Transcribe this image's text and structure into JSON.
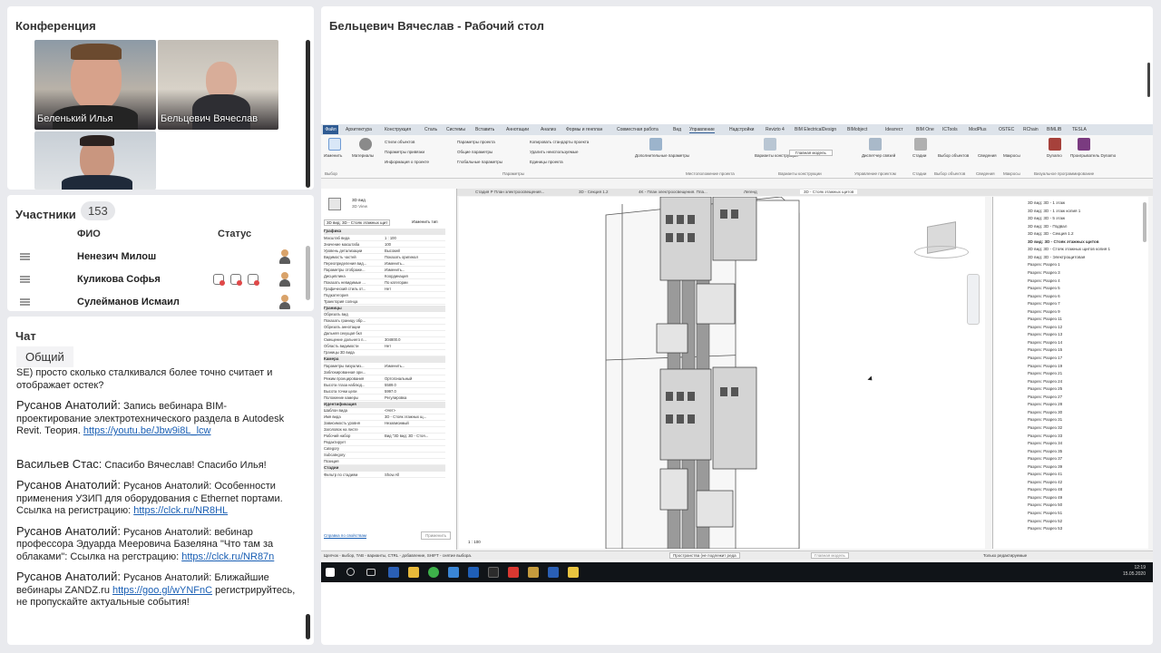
{
  "conference": {
    "title": "Конференция",
    "videos": [
      {
        "name": "Беленький Илья"
      },
      {
        "name": "Бельцевич Вячеслав"
      },
      {
        "name": ""
      }
    ]
  },
  "participants": {
    "title": "Участники",
    "count": "153",
    "col_name": "ФИО",
    "col_status": "Статус",
    "rows": [
      {
        "name": "Ненезич Милош"
      },
      {
        "name": "Куликова Софья"
      },
      {
        "name": "Сулейманов Исмаил"
      }
    ]
  },
  "chat": {
    "title": "Чат",
    "tab": "Общий",
    "intro": "SE) просто сколько сталкивался более точно считает и отображает остек?",
    "messages": [
      {
        "who": "Русанов Анатолий:",
        "text": "Запись вебинара BIM-проектирование электротехнического раздела в Autodesk Revit. Теория.",
        "link": "https://youtu.be/Jbw9i8L_lcw"
      },
      {
        "who": "Васильев Стас:",
        "text": "Спасибо Вячеслав! Спасибо Илья!",
        "link": ""
      },
      {
        "who": "Русанов Анатолий:",
        "text": "Русанов Анатолий: Особенности применения УЗИП для оборудования с Ethernet портами. Ссылка на регистрацию:",
        "link": "https://clck.ru/NR8HL"
      },
      {
        "who": "Русанов Анатолий:",
        "text": "Русанов Анатолий: вебинар профессора Эдуарда Мееровича Базеляна \"Что там за облаками\": Ссылка на регстрацию:",
        "link": "https://clck.ru/NR87n"
      },
      {
        "who": "Русанов Анатолий:",
        "text": "Русанов Анатолий: Ближайшие вебинары ZANDZ.ru",
        "link": "https://goo.gl/wYNFnC",
        "after": "регистрируйтесь, не пропускайте актуальные события!"
      }
    ]
  },
  "desktop": {
    "title": "Бельцевич Вячеслав - Рабочий стол",
    "menu": [
      "Файл",
      "Архитектура",
      "Конструкция",
      "Сталь",
      "Системы",
      "Вставить",
      "Аннотации",
      "Анализ",
      "Формы и генплан",
      "Совместная работа",
      "Вид",
      "Управление",
      "Надстройки",
      "Revizto 4",
      "BIM ElectricalDesign",
      "BIMobject",
      "Ideaтест",
      "BIM One",
      "ICTools",
      "ModPlus",
      "OSTEC",
      "RChain",
      "BIMLIB",
      "TESLA"
    ],
    "ribbon": [
      "Изменить",
      "Материалы",
      "Стили объектов",
      "Параметры привязки",
      "Информация о проекте",
      "Параметры проекта",
      "Общие параметры",
      "Глобальные параметры",
      "Копировать стандарты проекта",
      "Удалить неиспользуемые",
      "Единицы проекта",
      "Дополнительные параметры",
      "Варианты конструкции",
      "Главная модель",
      "Диспетчер связей",
      "Стадии",
      "Выбор объектов",
      "Сведения",
      "Макросы",
      "Dynamo",
      "Проигрыватель Dynamo"
    ],
    "ribbon_groups": [
      "Выбор",
      "Параметры",
      "Местоположение проекта",
      "Варианты конструкции",
      "Управление проектом",
      "Стадии",
      "Выбор объектов",
      "Сведения",
      "Макросы",
      "Визуальное программирование"
    ],
    "view_tabs": [
      "Свойства",
      "Стадия Р План электроосвещения...",
      "3D - Секция 1.2",
      "4K - План электроосвещения. Пла...",
      "Легенд",
      "3D - Стояк этажных щитов"
    ],
    "props": {
      "type": "3D вид",
      "type2": "3D View",
      "selector": "3D вид: 3D - Стояк этажных щит",
      "edit_type": "Изменить тип",
      "sections": [
        {
          "title": "Графика",
          "rows": [
            [
              "Масштаб вида",
              "1 : 100"
            ],
            [
              "Значение масштаба",
              "100"
            ],
            [
              "Уровень детализации",
              "Высокий"
            ],
            [
              "Видимость частей",
              "Показать оригинал"
            ],
            [
              "Переопределения вид...",
              "Изменить..."
            ],
            [
              "Параметры отображе...",
              "Изменить..."
            ],
            [
              "Дисциплина",
              "Координация"
            ],
            [
              "Показать невидимые ...",
              "По категории"
            ],
            [
              "Графический стиль от...",
              "Нет"
            ],
            [
              "Подкатегория",
              ""
            ],
            [
              "Траектория солнца",
              ""
            ]
          ]
        },
        {
          "title": "Границы",
          "rows": [
            [
              "Обрезать вид",
              ""
            ],
            [
              "Показать границу обр...",
              ""
            ],
            [
              "Обрезать аннотации",
              ""
            ],
            [
              "Дальняя секущая бкл",
              ""
            ],
            [
              "Смещение дальнего п...",
              "304800.0"
            ],
            [
              "Область видимости",
              "Нет"
            ],
            [
              "Границы 3D вида",
              ""
            ]
          ]
        },
        {
          "title": "Камера",
          "rows": [
            [
              "Параметры визуализ...",
              "Изменить..."
            ],
            [
              "Заблокированная ори...",
              ""
            ],
            [
              "Режим проецирования",
              "Ортогональный"
            ],
            [
              "Высота глаза наблюд...",
              "5589.0"
            ],
            [
              "Высота точки цели",
              "5997.0"
            ],
            [
              "Положение камеры",
              "Регулировка"
            ]
          ]
        },
        {
          "title": "Идентификация",
          "rows": [
            [
              "Шаблон вида",
              "<Нет>"
            ],
            [
              "Имя вида",
              "3D - Стояк этажных щ..."
            ],
            [
              "Зависимость уровня",
              "Независимый"
            ],
            [
              "Заголовок на листе",
              ""
            ],
            [
              "Рабочий набор",
              "Вид \"3D вид: 3D - Стоя..."
            ],
            [
              "Редактирует",
              ""
            ],
            [
              "Category",
              ""
            ],
            [
              "Subcategory",
              ""
            ],
            [
              "Позиция",
              ""
            ]
          ]
        },
        {
          "title": "Стадии",
          "rows": [
            [
              "Фильтр по стадиям",
              "Show All"
            ]
          ]
        }
      ],
      "help": "Справка по свойствам",
      "apply": "Применить"
    },
    "browser": [
      "3D вид: 3D - 1 этаж",
      "3D вид: 3D - 1 этаж копия 1",
      "3D вид: 3D - 5 этаж",
      "3D вид: 3D - Подвал",
      "3D вид: 3D - Секция 1.2",
      "3D вид: 3D - Стояк этажных щитов",
      "3D вид: 3D - Стояк этажных щитов копия 1",
      "3D вид: 3D - Электрощитовая",
      "Разрез: Разрез 1",
      "Разрез: Разрез 3",
      "Разрез: Разрез 4",
      "Разрез: Разрез 5",
      "Разрез: Разрез 6",
      "Разрез: Разрез 7",
      "Разрез: Разрез 9",
      "Разрез: Разрез 11",
      "Разрез: Разрез 12",
      "Разрез: Разрез 13",
      "Разрез: Разрез 14",
      "Разрез: Разрез 15",
      "Разрез: Разрез 17",
      "Разрез: Разрез 19",
      "Разрез: Разрез 21",
      "Разрез: Разрез 24",
      "Разрез: Разрез 25",
      "Разрез: Разрез 27",
      "Разрез: Разрез 28",
      "Разрез: Разрез 30",
      "Разрез: Разрез 31",
      "Разрез: Разрез 32",
      "Разрез: Разрез 33",
      "Разрез: Разрез 34",
      "Разрез: Разрез 35",
      "Разрез: Разрез 37",
      "Разрез: Разрез 39",
      "Разрез: Разрез 41",
      "Разрез: Разрез 42",
      "Разрез: Разрез 48",
      "Разрез: Разрез 49",
      "Разрез: Разрез 50",
      "Разрез: Разрез 51",
      "Разрез: Разрез 52",
      "Разрез: Разрез 53"
    ],
    "scale": "1 : 100",
    "status_text": "Щелчок - выбор, TAB - варианты, CTRL - добавление, SHIFT - снятие выбора.",
    "status_workset": "Пространства (не подлежит реда",
    "status_model": "Главная модель",
    "status_edit": "Только редактируемые",
    "clock_time": "12:19",
    "clock_date": "15.05.2020",
    "colors": {
      "accent": "#2f5b93",
      "taskbar": "#101418"
    }
  }
}
